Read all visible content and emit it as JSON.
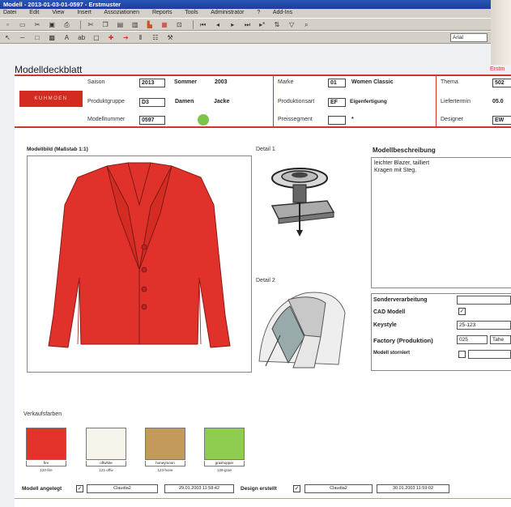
{
  "window": {
    "title": "Modell - 2013-01-03-01-0597 - Erstmuster"
  },
  "menu": [
    "Datei",
    "Edit",
    "View",
    "Insert",
    "Assoziationen",
    "Reports",
    "Tools",
    "Administrator",
    "?",
    "Add-Ins"
  ],
  "toolbar": {
    "font_value": "Arial"
  },
  "doc": {
    "title": "Modelldeckblatt",
    "right_label": "Erstm"
  },
  "header": {
    "brand": "KUHMOEN",
    "saison_label": "Saison",
    "saison_value": "2013",
    "saison_name": "Sommer",
    "saison_year": "2003",
    "produktgruppe_label": "Produktgruppe",
    "produktgruppe_value": "D3",
    "produktgruppe_name": "Damen",
    "produktgruppe_type": "Jacke",
    "modellnummer_label": "Modellnummer",
    "modellnummer_value": "0597",
    "marke_label": "Marke",
    "marke_value": "01",
    "marke_name": "Women Classic",
    "produktionsart_label": "Produktionsart",
    "produktionsart_value": "EF",
    "produktionsart_name": "Eigenfertigung",
    "preissegment_label": "Preissegment",
    "preissegment_value": "",
    "preissegment_mark": "*",
    "thema_label": "Thema",
    "thema_value": "502",
    "liefertermin_label": "Liefertermin",
    "liefertermin_value": "05.0",
    "designer_label": "Designer",
    "designer_value": "EW"
  },
  "main": {
    "modellbild_label": "Modellbild (Maßstab 1:1)",
    "detail1_label": "Detail 1",
    "detail2_label": "Detail 2",
    "beschreibung_label": "Modellbeschreibung",
    "beschreibung_text": "leichter Blazer, tailliert\nKragen mit Steg."
  },
  "props": {
    "sonderverarbeitung_label": "Sonderverarbeitung",
    "sonderverarbeitung_value": "",
    "cad_label": "CAD Modell",
    "cad_checked": "✓",
    "keystyle_label": "Keystyle",
    "keystyle_value": "25-123",
    "factory_label": "Factory (Produktion)",
    "factory_value": "025",
    "factory_name": "Tahe",
    "storniert_label": "Modell storniert",
    "storniert_value": ""
  },
  "colors": {
    "label": "Verkaufsfarben",
    "items": [
      {
        "name": "fire",
        "code": "120-fire",
        "hex": "#e3332b"
      },
      {
        "name": "offwhite",
        "code": "121-offw",
        "hex": "#f7f4ec"
      },
      {
        "name": "honeymoon",
        "code": "123-hone",
        "hex": "#c39a5a"
      },
      {
        "name": "grashopper",
        "code": "128-grae",
        "hex": "#8fcd50"
      }
    ]
  },
  "footer": {
    "angelegt_label": "Modell angelegt",
    "angelegt_check": "✓",
    "angelegt_user": "Claudia2",
    "angelegt_date": "29.01.2003 11:58:42",
    "design_label": "Design erstellt",
    "design_check": "✓",
    "design_user": "Claudia2",
    "design_date": "30.01.2003 11:59:02"
  },
  "accent": "#cc3333"
}
